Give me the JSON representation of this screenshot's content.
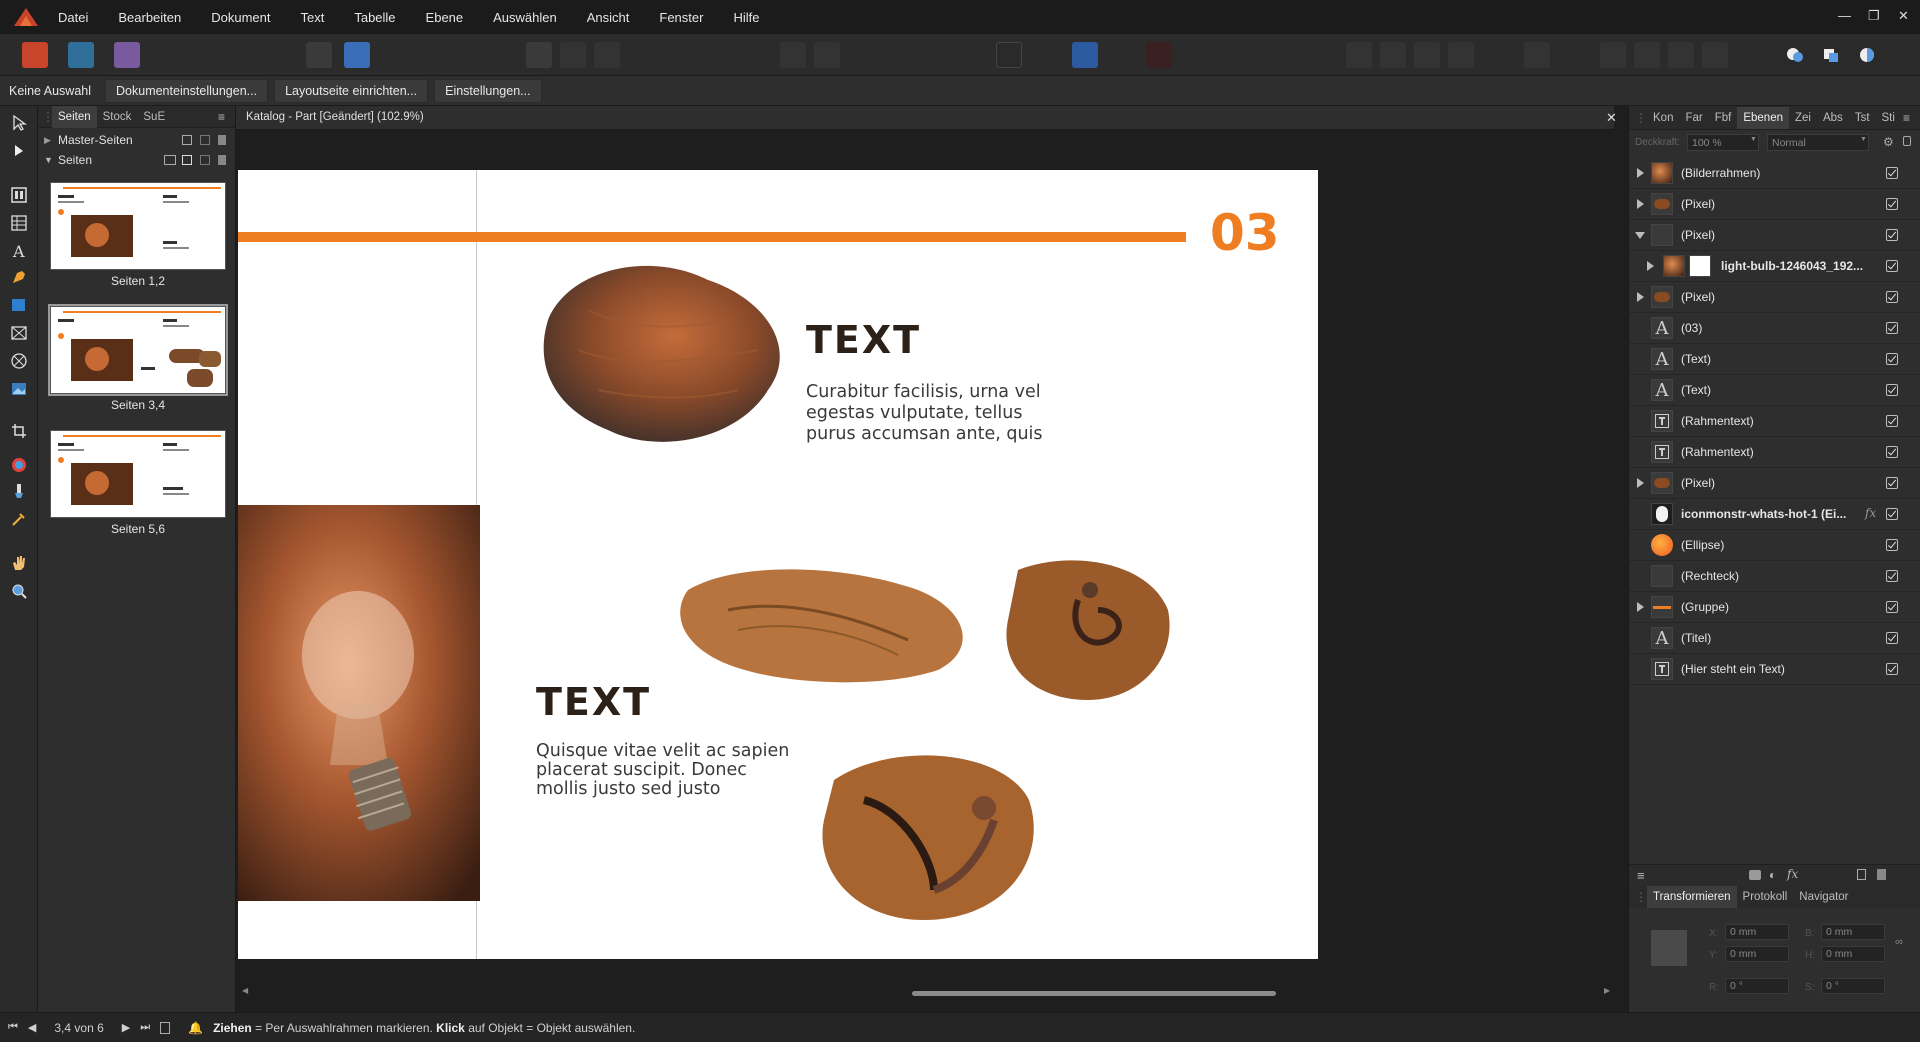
{
  "menu": [
    "Datei",
    "Bearbeiten",
    "Dokument",
    "Text",
    "Tabelle",
    "Ebene",
    "Auswählen",
    "Ansicht",
    "Fenster",
    "Hilfe"
  ],
  "context_bar": {
    "selection": "Keine Auswahl",
    "buttons": [
      "Dokumenteinstellungen...",
      "Layoutseite einrichten...",
      "Einstellungen..."
    ]
  },
  "pages_panel": {
    "tabs": [
      "Seiten",
      "Stock",
      "SuE"
    ],
    "master_pages": "Master-Seiten",
    "pages": "Seiten",
    "spreads": [
      {
        "label": "Seiten 1,2"
      },
      {
        "label": "Seiten 3,4"
      },
      {
        "label": "Seiten 5,6"
      }
    ]
  },
  "document": {
    "tab_title": "Katalog - Part [Geändert] (102.9%)",
    "page_number": "03",
    "heading1": "TEXT",
    "body1": [
      "Curabitur facilisis, urna vel",
      "egestas vulputate, tellus",
      "purus accumsan ante, quis"
    ],
    "heading2": "TEXT",
    "body2": [
      "Quisque vitae velit ac sapien",
      "placerat suscipit. Donec",
      "mollis justo sed justo"
    ]
  },
  "right_panel": {
    "tabs": [
      "Kon",
      "Far",
      "Fbf",
      "Ebenen",
      "Zei",
      "Abs",
      "Tst",
      "Sti"
    ],
    "opacity_label": "Deckkraft:",
    "opacity": "100 %",
    "blend_mode": "Normal",
    "layers": [
      {
        "name": "(Bilderrahmen)",
        "expander": "closed",
        "icon": "photo"
      },
      {
        "name": "(Pixel)",
        "expander": "closed",
        "icon": "pixel-brown"
      },
      {
        "name": "(Pixel)",
        "expander": "open",
        "icon": "empty"
      },
      {
        "name": "light-bulb-1246043_192...",
        "expander": "child",
        "icon": "photo",
        "bold": true
      },
      {
        "name": "(Pixel)",
        "expander": "closed",
        "icon": "pixel-brown"
      },
      {
        "name": "(03)",
        "expander": "none",
        "icon": "A"
      },
      {
        "name": "(Text)",
        "expander": "none",
        "icon": "A"
      },
      {
        "name": "(Text)",
        "expander": "none",
        "icon": "A"
      },
      {
        "name": "(Rahmentext)",
        "expander": "none",
        "icon": "T"
      },
      {
        "name": "(Rahmentext)",
        "expander": "none",
        "icon": "T"
      },
      {
        "name": "(Pixel)",
        "expander": "closed",
        "icon": "pixel-brown"
      },
      {
        "name": "iconmonstr-whats-hot-1 (Ei...",
        "expander": "none",
        "icon": "flame",
        "bold": true,
        "fx": true
      },
      {
        "name": "(Ellipse)",
        "expander": "none",
        "icon": "ellipse"
      },
      {
        "name": "(Rechteck)",
        "expander": "none",
        "icon": "empty"
      },
      {
        "name": "(Gruppe)",
        "expander": "closed",
        "icon": "group"
      },
      {
        "name": "(Titel)",
        "expander": "none",
        "icon": "A"
      },
      {
        "name": "(Hier steht ein Text)",
        "expander": "none",
        "icon": "T"
      }
    ],
    "bottom_tabs": [
      "Transformieren",
      "Protokoll",
      "Navigator"
    ],
    "transform": {
      "x_label": "X:",
      "x": "0 mm",
      "y_label": "Y:",
      "y": "0 mm",
      "b_label": "B:",
      "b": "0 mm",
      "h_label": "H:",
      "h": "0 mm",
      "r_label": "R:",
      "r": "0 °",
      "s_label": "S:",
      "s": "0 °"
    }
  },
  "status": {
    "page": "3,4 von 6",
    "hint_bold1": "Ziehen",
    "hint1": " = Per Auswahlrahmen markieren. ",
    "hint_bold2": "Klick",
    "hint2": " auf Objekt = Objekt auswählen."
  },
  "colors": {
    "accent": "#ef7d22",
    "heading_dark": "#2b2118"
  }
}
